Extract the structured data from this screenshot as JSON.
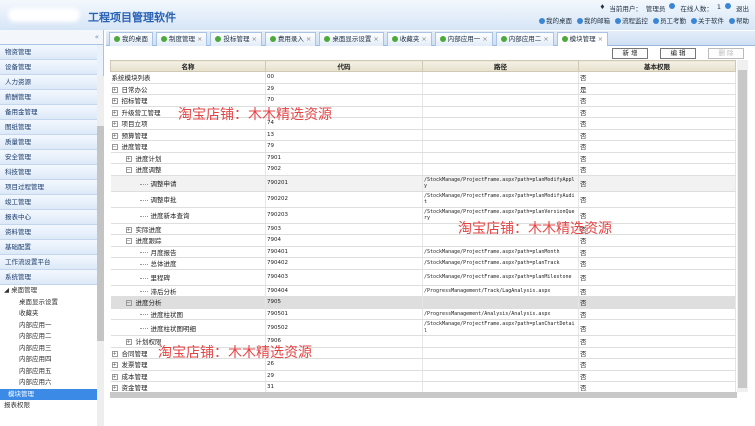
{
  "header": {
    "title": "工程项目管理软件",
    "current_user_label": "当前用户：",
    "current_user": "管理员",
    "online_label": "在线人数：",
    "online_count": "1",
    "logout": "退出",
    "links": [
      "我的桌面",
      "我的邮箱",
      "流程监控",
      "员工考勤",
      "关于软件",
      "帮助"
    ]
  },
  "sidebar": {
    "collapse": "«",
    "items": [
      "物资管理",
      "设备管理",
      "人力资源",
      "薪酬管理",
      "备用金管理",
      "图纸管理",
      "质量管理",
      "安全管理",
      "科技管理",
      "项目过程管理",
      "竣工管理",
      "报表中心",
      "资料管理",
      "基础配置",
      "工作流设置平台",
      "系统管理"
    ],
    "group": "桌面管理",
    "sub": [
      "桌面显示设置",
      "收藏夹",
      "内部应用一",
      "内部应用二",
      "内部应用三",
      "内部应用四",
      "内部应用五",
      "内部应用六"
    ],
    "selected": "模块管理",
    "next": "报表权限"
  },
  "tabs": [
    "我的桌面",
    "制度管理",
    "投标管理",
    "费用录入",
    "桌面显示设置",
    "收藏夹",
    "内部应用一",
    "内部应用二",
    "模块管理"
  ],
  "toolbar": {
    "add": "新 增",
    "edit": "编 辑",
    "delete": "删 除"
  },
  "table": {
    "headers": [
      "名称",
      "代码",
      "路径",
      "基本权限"
    ],
    "rows": [
      {
        "l": 0,
        "t": "none",
        "name": "系统模块列表",
        "code": "00",
        "path": "",
        "perm": "否"
      },
      {
        "l": 0,
        "t": "plus",
        "name": "日常办公",
        "code": "29",
        "path": "",
        "perm": "是"
      },
      {
        "l": 0,
        "t": "plus",
        "name": "招标管理",
        "code": "70",
        "path": "",
        "perm": "否"
      },
      {
        "l": 0,
        "t": "plus",
        "name": "升级营工管理",
        "code": "",
        "path": "",
        "perm": "否"
      },
      {
        "l": 0,
        "t": "plus",
        "name": "项目立项",
        "code": "74",
        "path": "",
        "perm": "否"
      },
      {
        "l": 0,
        "t": "plus",
        "name": "预算管理",
        "code": "13",
        "path": "",
        "perm": "否"
      },
      {
        "l": 0,
        "t": "minus",
        "name": "进度管理",
        "code": "79",
        "path": "",
        "perm": "否"
      },
      {
        "l": 1,
        "t": "plus",
        "name": "进度计划",
        "code": "7901",
        "path": "",
        "perm": "否"
      },
      {
        "l": 1,
        "t": "minus",
        "name": "进度调整",
        "code": "7902",
        "path": "",
        "perm": "否"
      },
      {
        "l": 2,
        "t": "leaf",
        "name": "调整申请",
        "code": "790201",
        "path": "/StockManage/ProjectFrame.aspx?path=planModifyApply",
        "perm": "否",
        "alt": true
      },
      {
        "l": 2,
        "t": "leaf",
        "name": "调整审批",
        "code": "790202",
        "path": "/StockManage/ProjectFrame.aspx?path=planModifyAudit",
        "perm": "否"
      },
      {
        "l": 2,
        "t": "leaf",
        "name": "进度新本查询",
        "code": "790203",
        "path": "/StockManage/ProjectFrame.aspx?path=planVersionQuery",
        "perm": "否"
      },
      {
        "l": 1,
        "t": "plus",
        "name": "实际进度",
        "code": "7903",
        "path": "",
        "perm": "否"
      },
      {
        "l": 1,
        "t": "minus",
        "name": "进度跟踪",
        "code": "7904",
        "path": "",
        "perm": "否"
      },
      {
        "l": 2,
        "t": "leaf",
        "name": "月度报告",
        "code": "790401",
        "path": "/StockManage/ProjectFrame.aspx?path=planMonth",
        "perm": "否"
      },
      {
        "l": 2,
        "t": "leaf",
        "name": "总体进度",
        "code": "790402",
        "path": "/StockManage/ProjectFrame.aspx?path=planTrack",
        "perm": "否"
      },
      {
        "l": 2,
        "t": "leaf",
        "name": "里程碑",
        "code": "790403",
        "path": "/StockManage/ProjectFrame.aspx?path=planMilestone",
        "perm": "否"
      },
      {
        "l": 2,
        "t": "leaf",
        "name": "滞后分析",
        "code": "790404",
        "path": "/ProgressManagement/Track/LagAnalysis.aspx",
        "perm": "否"
      },
      {
        "l": 1,
        "t": "minus",
        "name": "进度分析",
        "code": "7905",
        "path": "",
        "perm": "否",
        "hl": true
      },
      {
        "l": 2,
        "t": "leaf",
        "name": "进度柱状图",
        "code": "790501",
        "path": "/ProgressManagement/Analysis/Analysis.aspx",
        "perm": "否"
      },
      {
        "l": 2,
        "t": "leaf",
        "name": "进度柱状图明细",
        "code": "790502",
        "path": "/StockManage/ProjectFrame.aspx?path=planChartDetail",
        "perm": "否"
      },
      {
        "l": 1,
        "t": "plus",
        "name": "计划权限",
        "code": "7906",
        "path": "",
        "perm": "否"
      },
      {
        "l": 0,
        "t": "plus",
        "name": "合同管理",
        "code": "",
        "path": "",
        "perm": "否"
      },
      {
        "l": 0,
        "t": "plus",
        "name": "发票管理",
        "code": "26",
        "path": "",
        "perm": "否"
      },
      {
        "l": 0,
        "t": "plus",
        "name": "成本管理",
        "code": "29",
        "path": "",
        "perm": "否"
      },
      {
        "l": 0,
        "t": "plus",
        "name": "资金管理",
        "code": "31",
        "path": "",
        "perm": "否"
      }
    ]
  },
  "watermark": "淘宝店铺：木木精选资源"
}
